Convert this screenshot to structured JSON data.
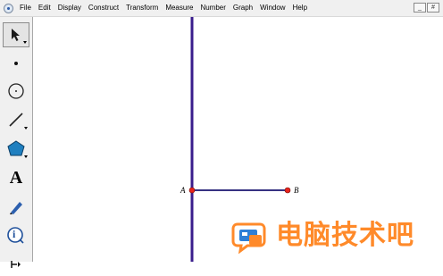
{
  "menu": {
    "items": [
      "File",
      "Edit",
      "Display",
      "Construct",
      "Transform",
      "Measure",
      "Number",
      "Graph",
      "Window",
      "Help"
    ],
    "window_controls": [
      "_",
      "#"
    ]
  },
  "toolbox": {
    "tools": [
      {
        "name": "arrow-tool",
        "icon": "arrow-icon",
        "selected": true
      },
      {
        "name": "point-tool",
        "icon": "point-icon"
      },
      {
        "name": "compass-tool",
        "icon": "circle-icon"
      },
      {
        "name": "straightedge-tool",
        "icon": "line-icon"
      },
      {
        "name": "polygon-tool",
        "icon": "polygon-icon"
      },
      {
        "name": "text-tool",
        "icon": "text-icon",
        "label": "A"
      },
      {
        "name": "marker-tool",
        "icon": "marker-icon"
      },
      {
        "name": "information-tool",
        "icon": "info-icon",
        "label": "i"
      },
      {
        "name": "custom-tool",
        "icon": "custom-tool-icon"
      }
    ]
  },
  "canvas": {
    "points": [
      {
        "id": "A",
        "label": "A"
      },
      {
        "id": "B",
        "label": "B"
      }
    ],
    "line_color": "#3a1d8c",
    "segment_color": "#1a1570",
    "point_color": "#e8241c"
  },
  "watermark": {
    "text": "电脑技术吧",
    "color": "#ff8a2a",
    "icon_color": "#2e7fd6"
  }
}
